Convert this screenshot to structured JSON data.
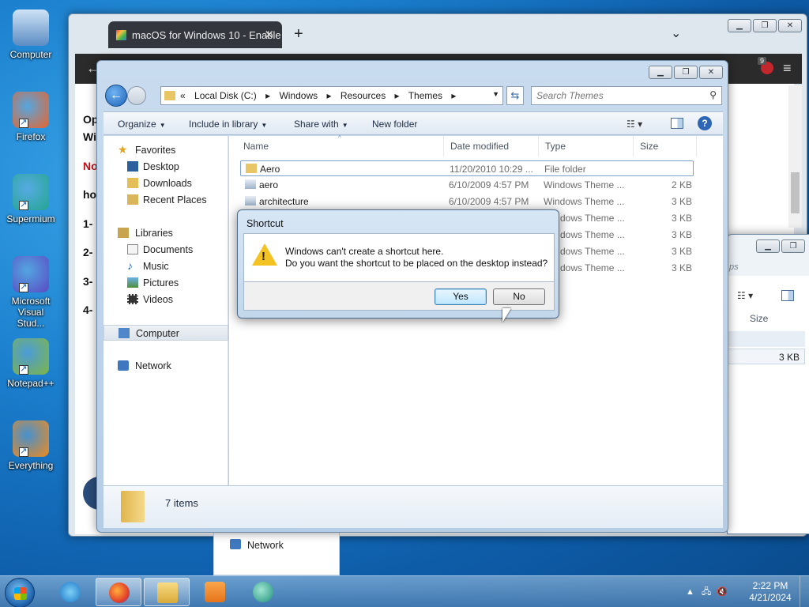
{
  "desktop_icons": [
    {
      "label": "Computer",
      "icon": "computer-icon",
      "color": "#5aa0e0"
    },
    {
      "label": "Firefox",
      "icon": "firefox-icon",
      "color": "#e8632b"
    },
    {
      "label": "Supermium",
      "icon": "supermium-icon",
      "color": "#23a58f"
    },
    {
      "label": "Microsoft Visual Stud...",
      "icon": "visual-studio-icon",
      "color": "#5b4ac4"
    },
    {
      "label": "Notepad++",
      "icon": "notepadpp-icon",
      "color": "#7fb644"
    },
    {
      "label": "Everything",
      "icon": "everything-icon",
      "color": "#f08a1c"
    }
  ],
  "browser": {
    "tab_title": "macOS for Windows 10 - Enable",
    "page_lines": [
      "Op",
      "Wi",
      "No",
      "ho",
      "1-",
      "2-",
      "3-",
      "4-"
    ],
    "extension_badge": "9"
  },
  "explorer": {
    "breadcrumb": [
      "«",
      "Local Disk (C:)",
      "▸",
      "Windows",
      "▸",
      "Resources",
      "▸",
      "Themes",
      "▸"
    ],
    "search_placeholder": "Search Themes",
    "commands": {
      "organize": "Organize",
      "include": "Include in library",
      "share": "Share with",
      "new_folder": "New folder"
    },
    "nav": {
      "favorites": "Favorites",
      "desktop": "Desktop",
      "downloads": "Downloads",
      "recent": "Recent Places",
      "libraries": "Libraries",
      "documents": "Documents",
      "music": "Music",
      "pictures": "Pictures",
      "videos": "Videos",
      "computer": "Computer",
      "network": "Network"
    },
    "columns": {
      "name": "Name",
      "date": "Date modified",
      "type": "Type",
      "size": "Size"
    },
    "files": [
      {
        "name": "Aero",
        "date": "11/20/2010 10:29 ...",
        "type": "File folder",
        "size": ""
      },
      {
        "name": "aero",
        "date": "6/10/2009 4:57 PM",
        "type": "Windows Theme ...",
        "size": "2 KB"
      },
      {
        "name": "architecture",
        "date": "6/10/2009 4:57 PM",
        "type": "Windows Theme ...",
        "size": "3 KB"
      },
      {
        "name": "",
        "date": "",
        "type": "dows Theme ...",
        "size": "3 KB"
      },
      {
        "name": "",
        "date": "",
        "type": "dows Theme ...",
        "size": "3 KB"
      },
      {
        "name": "",
        "date": "",
        "type": "dows Theme ...",
        "size": "3 KB"
      },
      {
        "name": "",
        "date": "",
        "type": "dows Theme ...",
        "size": "3 KB"
      }
    ],
    "status_count": "7 items"
  },
  "explorer2": {
    "size_header": "Size",
    "row_size": "3 KB",
    "partial_text": "ps"
  },
  "bgnav": {
    "network": "Network"
  },
  "dialog": {
    "title": "Shortcut",
    "line1": "Windows can't create a shortcut here.",
    "line2": "Do you want the shortcut to be placed on the desktop instead?",
    "yes": "Yes",
    "no": "No"
  },
  "taskbar": {
    "time": "2:22 PM",
    "date": "4/21/2024"
  }
}
